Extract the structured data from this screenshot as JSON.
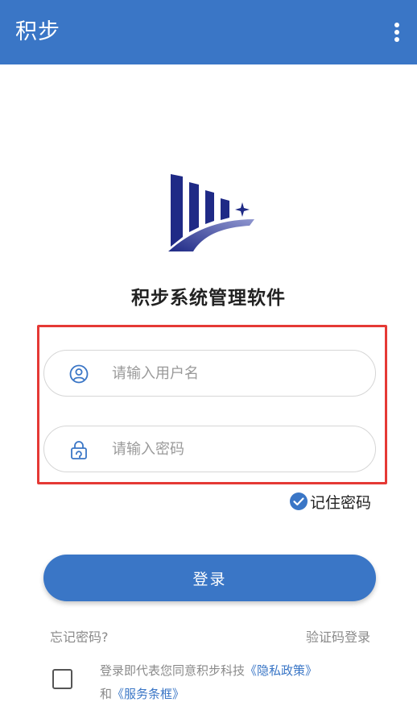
{
  "appbar": {
    "title": "积步",
    "menu_icon": "more-vert-icon"
  },
  "branding": {
    "app_name": "积步系统管理软件"
  },
  "login_form": {
    "username": {
      "placeholder": "请输入用户名",
      "value": "",
      "icon": "user-circle-icon"
    },
    "password": {
      "placeholder": "请输入密码",
      "value": "",
      "icon": "lock-icon"
    }
  },
  "remember": {
    "label": "记住密码",
    "checked": true
  },
  "login_button": {
    "label": "登录"
  },
  "links": {
    "forgot_password": "忘记密码?",
    "sms_login": "验证码登录"
  },
  "agreement": {
    "checked": false,
    "text_prefix": "登录即代表您同意积步科技",
    "privacy_link": "《隐私政策》",
    "conjunction": "和",
    "terms_link": "《服务条框》"
  },
  "colors": {
    "primary": "#3a76c6",
    "highlight_frame": "#e53935",
    "logo_dark": "#1f2a86"
  }
}
